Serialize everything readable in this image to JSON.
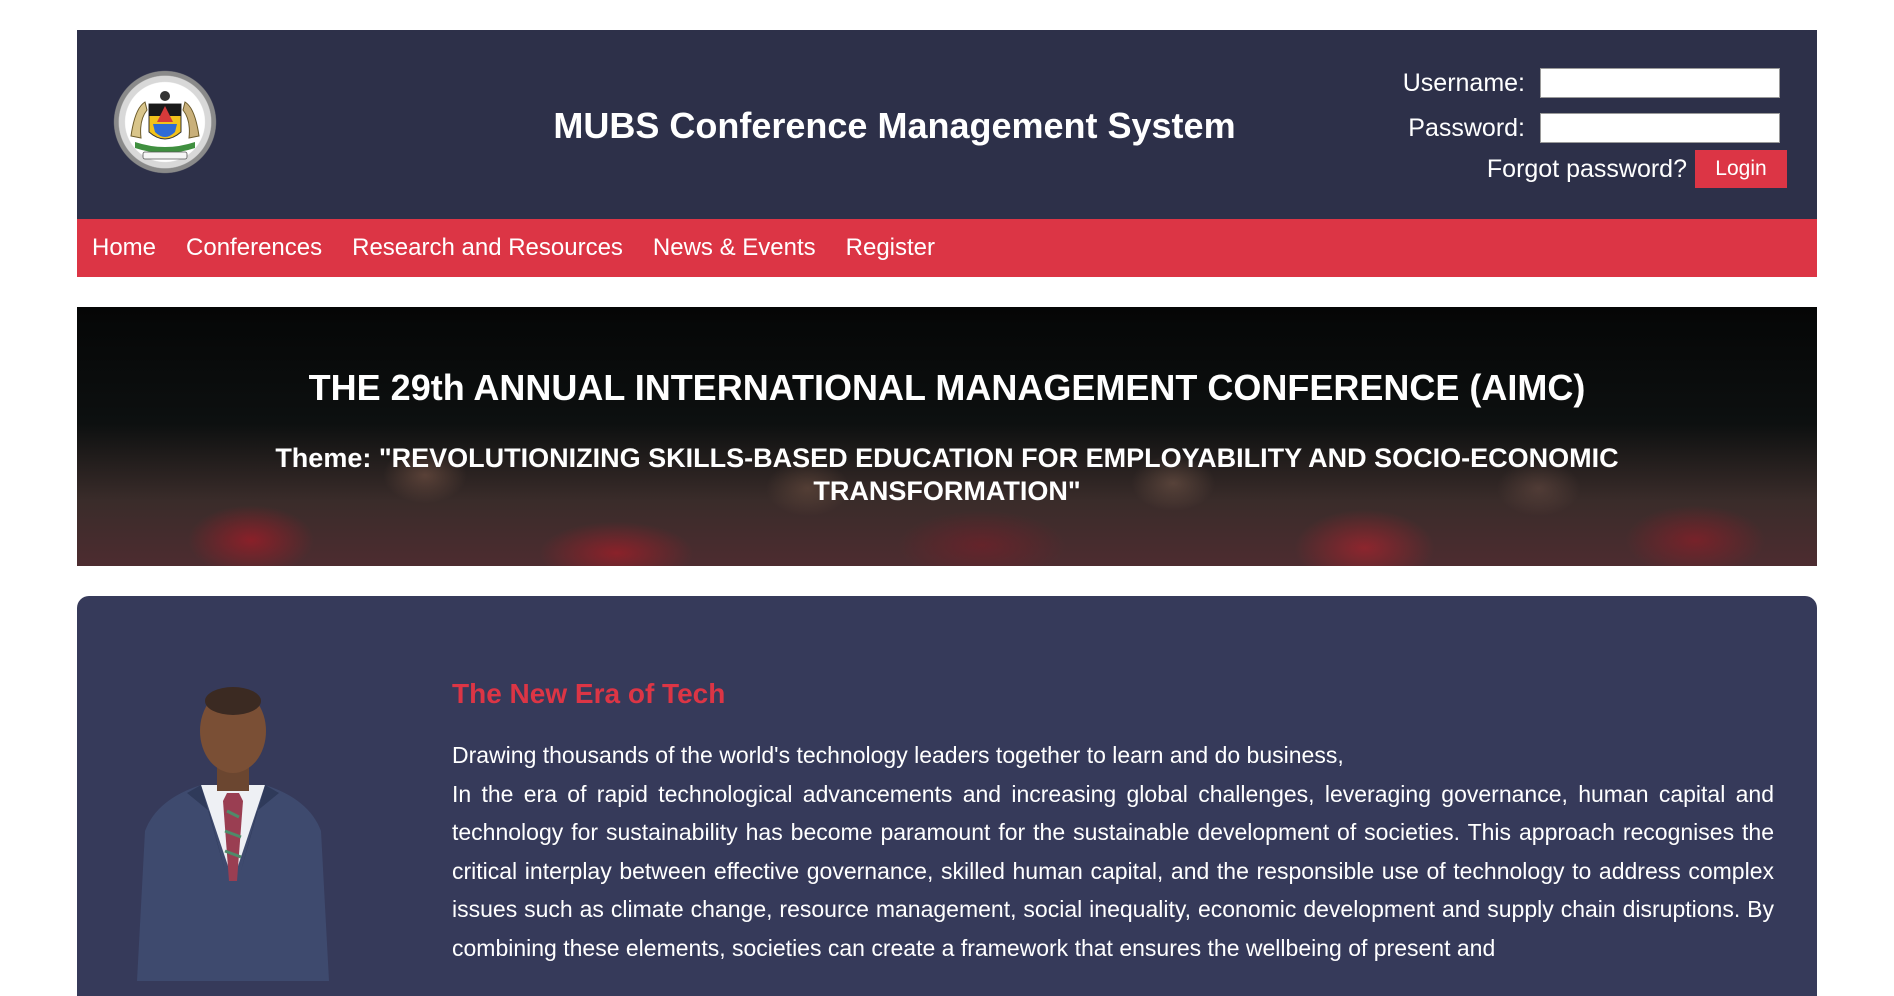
{
  "header": {
    "title": "MUBS Conference Management System",
    "username_label": "Username:",
    "username_value": "",
    "password_label": "Password:",
    "password_value": "",
    "forgot_password": "Forgot password?",
    "login_label": "Login"
  },
  "nav": {
    "items": [
      {
        "label": "Home"
      },
      {
        "label": "Conferences"
      },
      {
        "label": "Research and Resources"
      },
      {
        "label": "News & Events"
      },
      {
        "label": "Register"
      }
    ]
  },
  "banner": {
    "title": "THE 29th ANNUAL INTERNATIONAL MANAGEMENT CONFERENCE (AIMC)",
    "theme": "Theme: \"REVOLUTIONIZING SKILLS-BASED EDUCATION FOR EMPLOYABILITY AND SOCIO-ECONOMIC TRANSFORMATION\""
  },
  "content": {
    "heading": "The New Era of Tech",
    "intro": "Drawing thousands of the world's technology leaders together to learn and do business,",
    "body": "In the era of rapid technological advancements and increasing global challenges, leveraging governance, human capital and technology for sustainability has become paramount for the sustainable development of societies. This approach recognises the critical interplay between effective governance, skilled human capital, and the responsible use of technology to address complex issues such as climate change, resource management, social inequality, economic development and supply chain disruptions. By combining these elements, societies can create a framework that ensures the wellbeing of present and"
  },
  "colors": {
    "header_bg": "#2d3049",
    "accent": "#dc3545",
    "card_bg": "#363a5a"
  }
}
